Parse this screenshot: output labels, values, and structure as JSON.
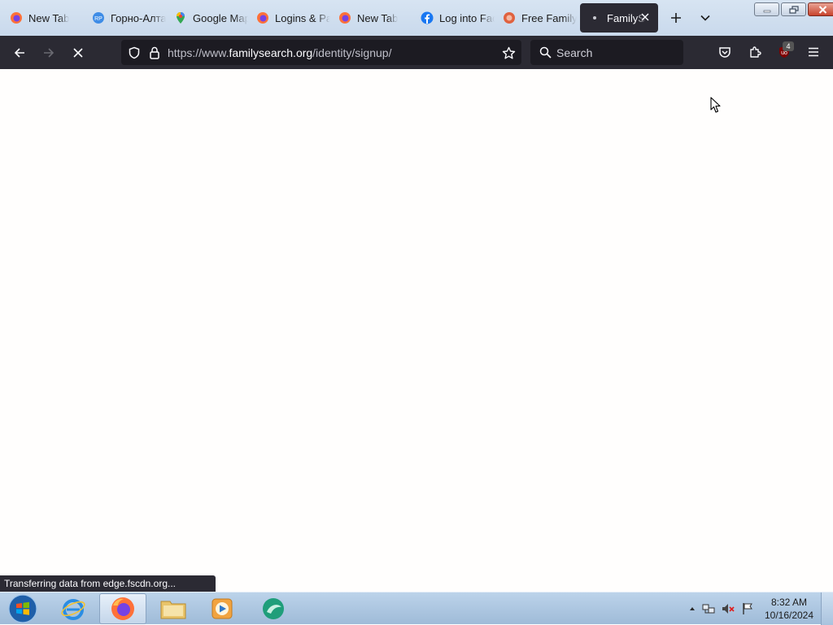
{
  "tabs": [
    {
      "label": "New Tab",
      "icon": "firefox-icon"
    },
    {
      "label": "Горно-Алтайск",
      "icon": "yandex-weather-icon"
    },
    {
      "label": "Google Maps",
      "icon": "google-maps-icon"
    },
    {
      "label": "Logins & Passwords",
      "icon": "firefox-icon"
    },
    {
      "label": "New Tab",
      "icon": "firefox-icon"
    },
    {
      "label": "Log into Facebook",
      "icon": "facebook-icon"
    },
    {
      "label": "Free Family Tree",
      "icon": "familysearch-icon"
    },
    {
      "label": "FamilySearch",
      "icon": "loading-dot-icon",
      "active": true
    }
  ],
  "url": {
    "prefix": "https://www.",
    "domain": "familysearch.org",
    "path": "/identity/signup/"
  },
  "search": {
    "placeholder": "Search"
  },
  "extensions_badge": "4",
  "status_text": "Transferring data from edge.fscdn.org...",
  "clock": {
    "time": "8:32 AM",
    "date": "10/16/2024"
  },
  "colors": {
    "toolbar": "#2b2a33",
    "urlbar": "#1c1b22",
    "tabstrip": "#d0deee",
    "taskbar": "#a9c3df"
  }
}
